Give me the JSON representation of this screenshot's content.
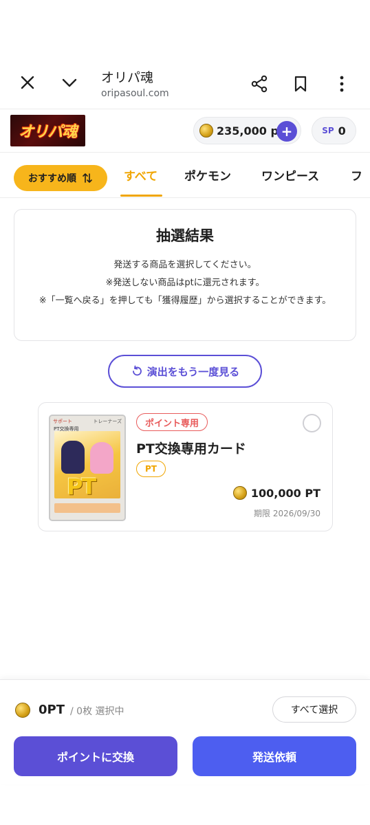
{
  "browser": {
    "title": "オリパ魂",
    "url": "oripasoul.com",
    "icons": [
      "close-icon",
      "chevron-down-icon",
      "share-icon",
      "bookmark-icon",
      "more-vert-icon"
    ]
  },
  "header": {
    "logo_text": "オリパ魂",
    "points": "235,000 pt",
    "plus_label": "+",
    "sp_label": "SP",
    "sp_value": "0"
  },
  "tabs": {
    "sort_label": "おすすめ順",
    "items": [
      {
        "label": "すべて",
        "active": true
      },
      {
        "label": "ポケモン",
        "active": false
      },
      {
        "label": "ワンピース",
        "active": false
      },
      {
        "label": "フ",
        "active": false
      }
    ]
  },
  "result": {
    "title": "抽選結果",
    "line1": "発送する商品を選択してください。",
    "line2": "※発送しない商品はptに還元されます。",
    "note": "※「一覧へ戻る」を押しても「獲得履歴」から選択することができます。"
  },
  "replay_label": "演出をもう一度見る",
  "card": {
    "badge": "ポイント専用",
    "name": "PT交換専用カード",
    "tag": "PT",
    "price": "100,000 PT",
    "expiry": "期限 2026/09/30",
    "image": {
      "top_left": "サポート",
      "top_right": "トレーナーズ",
      "label": "PT交換専用",
      "big_text": "PT"
    }
  },
  "bottom": {
    "total": "0PT",
    "count": "/ 0枚 選択中",
    "select_all": "すべて選択",
    "exchange": "ポイントに交換",
    "ship": "発送依頼"
  },
  "colors": {
    "accent_purple": "#5b4fd6",
    "accent_blue": "#4d5ef0",
    "accent_orange": "#f0a500",
    "sort_yellow": "#f7b51b",
    "badge_red": "#e85a5a"
  }
}
